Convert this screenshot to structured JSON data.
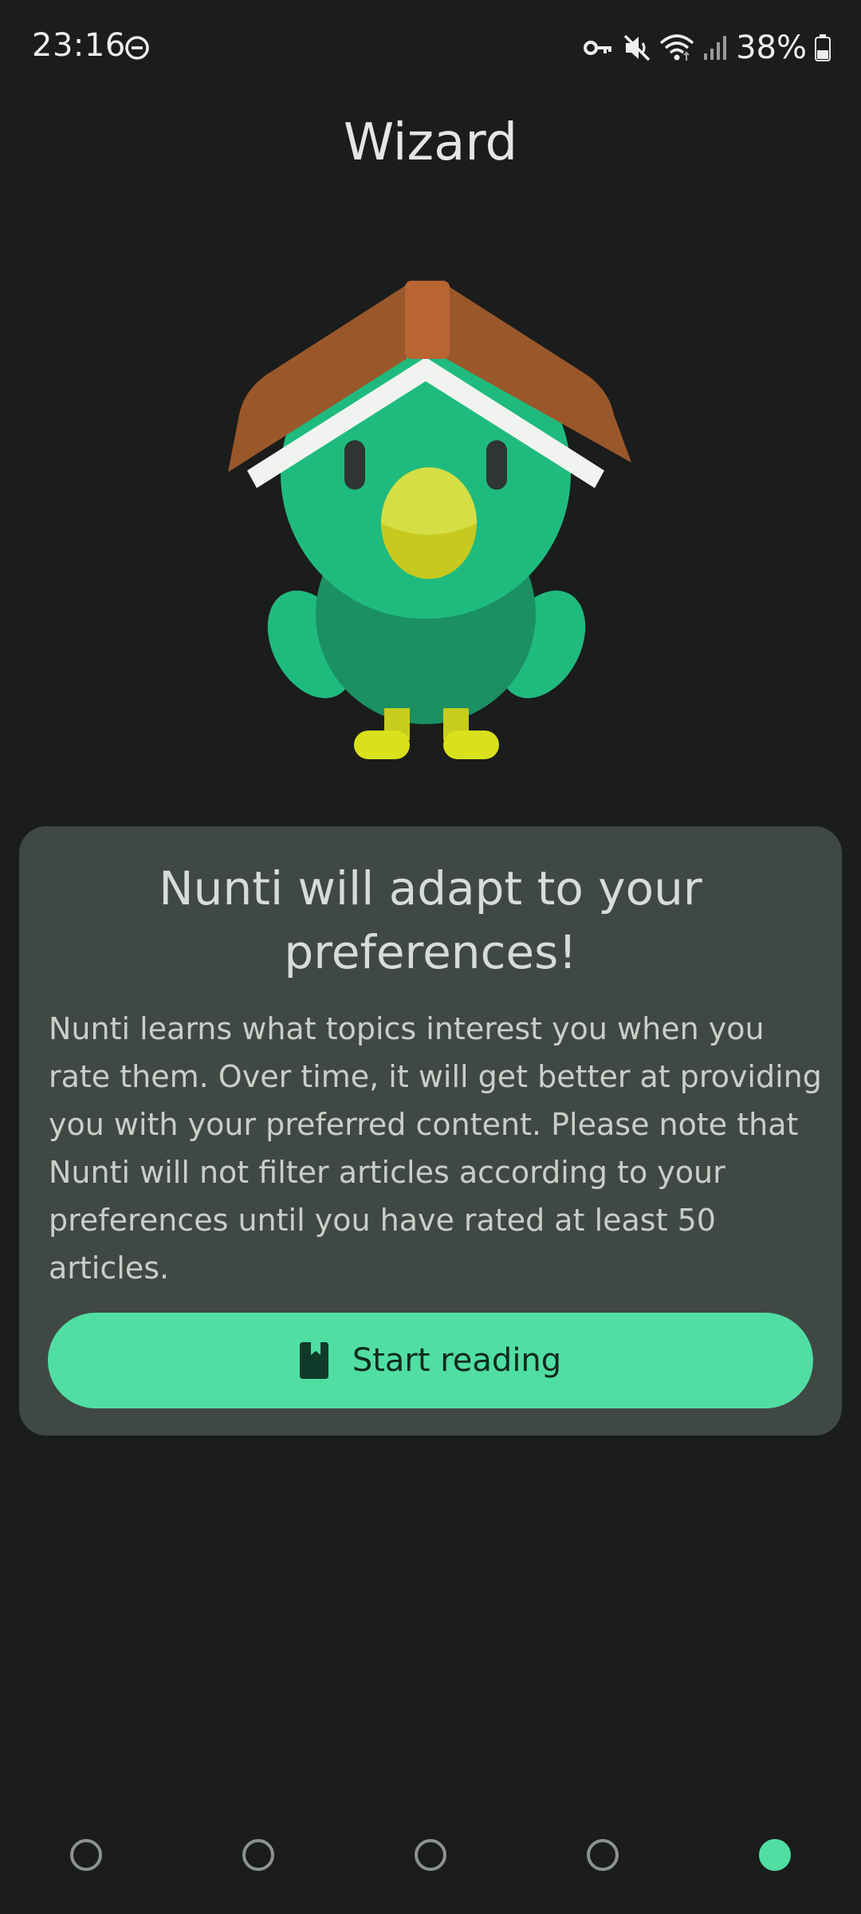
{
  "status_bar": {
    "time": "23:16",
    "battery": "38%",
    "icons": [
      "do-not-disturb-icon",
      "vpn-key-icon",
      "mute-icon",
      "wifi-icon",
      "signal-icon",
      "battery-icon"
    ]
  },
  "header": {
    "title": "Wizard"
  },
  "mascot": {
    "icon": "nunti-bird-mascot"
  },
  "card": {
    "heading": "Nunti will adapt to your preferences!",
    "body": "Nunti learns what topics interest you when you rate them. Over time, it will get better at providing you with your preferred content. Please note that Nunti will not filter articles according to your preferences until you have rated at least 50 articles.",
    "button": {
      "label": "Start reading",
      "icon": "book-icon"
    }
  },
  "page_indicator": {
    "total": 5,
    "current": 5
  },
  "colors": {
    "background": "#1b1c1c",
    "card": "#404844",
    "accent": "#50dea3"
  }
}
